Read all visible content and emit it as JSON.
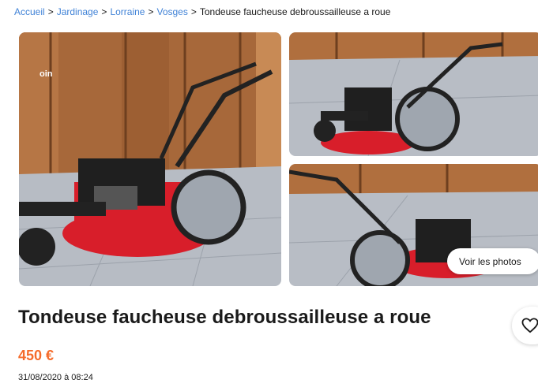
{
  "breadcrumb": {
    "items": [
      "Accueil",
      "Jardinage",
      "Lorraine",
      "Vosges"
    ],
    "current": "Tondeuse faucheuse debroussailleuse a roue",
    "separator": ">"
  },
  "gallery": {
    "main_badge": "oin",
    "see_photos_label": "Voir les photos"
  },
  "listing": {
    "title": "Tondeuse faucheuse debroussailleuse a roue",
    "price": "450 €",
    "date": "31/08/2020 à 08:24"
  },
  "icons": {
    "favorite": "heart-icon"
  },
  "colors": {
    "link": "#4183d7",
    "price": "#f56b2a",
    "mower_red": "#d81e2a",
    "wood": "#a86a3a"
  }
}
